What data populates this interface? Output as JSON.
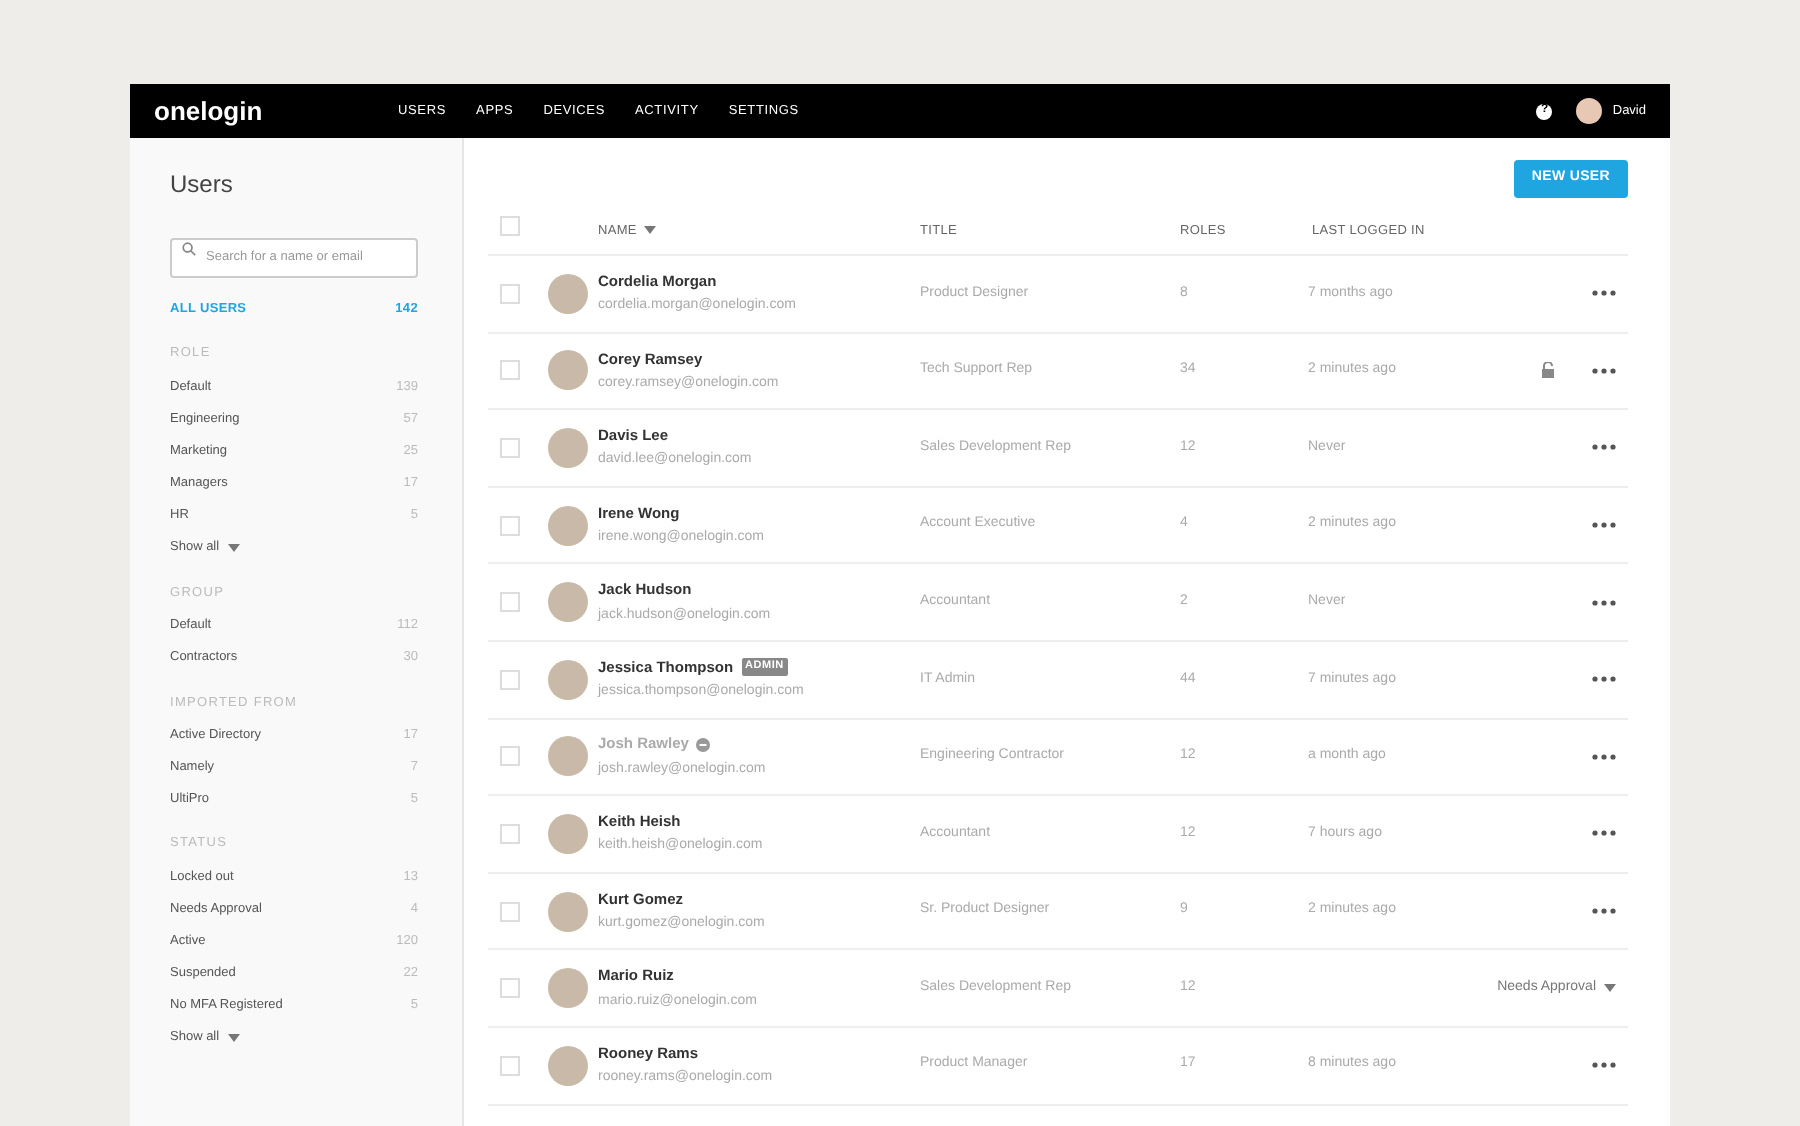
{
  "nav": {
    "logo": "onelogin",
    "links": [
      "USERS",
      "APPS",
      "DEVICES",
      "ACTIVITY",
      "SETTINGS"
    ],
    "help": "?",
    "user": "David"
  },
  "sidebar": {
    "title": "Users",
    "search": {
      "placeholder": "Search for a name or email"
    },
    "all": {
      "label": "ALL USERS",
      "count": "142",
      "selected": true
    },
    "sections": [
      {
        "heading": "ROLE",
        "items": [
          {
            "label": "Default",
            "count": "139",
            "selected": false
          },
          {
            "label": "Engineering",
            "count": "57",
            "selected": false
          },
          {
            "label": "Marketing",
            "count": "25",
            "selected": false
          },
          {
            "label": "Managers",
            "count": "17",
            "selected": false
          },
          {
            "label": "HR",
            "count": "5",
            "selected": false
          }
        ],
        "show_all": "Show all"
      },
      {
        "heading": "GROUP",
        "items": [
          {
            "label": "Default",
            "count": "112",
            "selected": false
          },
          {
            "label": "Contractors",
            "count": "30",
            "selected": false
          }
        ]
      },
      {
        "heading": "IMPORTED FROM",
        "items": [
          {
            "label": "Active Directory",
            "count": "17",
            "selected": false
          },
          {
            "label": "Namely",
            "count": "7",
            "selected": false
          },
          {
            "label": "UltiPro",
            "count": "5",
            "selected": false
          }
        ]
      },
      {
        "heading": "STATUS",
        "items": [
          {
            "label": "Locked out",
            "count": "13",
            "selected": false
          },
          {
            "label": "Needs Approval",
            "count": "4",
            "selected": false
          },
          {
            "label": "Active",
            "count": "120",
            "selected": false
          },
          {
            "label": "Suspended",
            "count": "22",
            "selected": false
          },
          {
            "label": "No MFA Registered",
            "count": "5",
            "selected": false
          }
        ],
        "show_all": "Show all"
      }
    ]
  },
  "new_user": "NEW USER",
  "table": {
    "select_all": {
      "checked": false
    },
    "columns": [
      "NAME",
      "TITLE",
      "ROLES",
      "LAST LOGGED IN"
    ],
    "rows": [
      {
        "name": "Cordelia Morgan",
        "email": "cordelia.morgan@onelogin.com",
        "title": "Product Designer",
        "roles": "8",
        "last": "7 months ago",
        "checked": false,
        "locked": false,
        "suspended": false
      },
      {
        "name": "Corey Ramsey",
        "email": "corey.ramsey@onelogin.com",
        "title": "Tech Support Rep",
        "roles": "34",
        "last": "2 minutes ago",
        "checked": false,
        "locked": true,
        "suspended": false
      },
      {
        "name": "Davis Lee",
        "email": "david.lee@onelogin.com",
        "title": "Sales Development Rep",
        "roles": "12",
        "last": "Never",
        "checked": false,
        "locked": false,
        "suspended": false
      },
      {
        "name": "Irene Wong",
        "email": "irene.wong@onelogin.com",
        "title": "Account Executive",
        "roles": "4",
        "last": "2 minutes ago",
        "checked": false,
        "locked": false,
        "suspended": false
      },
      {
        "name": "Jack Hudson",
        "email": "jack.hudson@onelogin.com",
        "title": "Accountant",
        "roles": "2",
        "last": "Never",
        "checked": false,
        "locked": false,
        "suspended": false
      },
      {
        "name": "Jessica Thompson",
        "badge": "ADMIN",
        "email": "jessica.thompson@onelogin.com",
        "title": "IT Admin",
        "roles": "44",
        "last": "7 minutes ago",
        "checked": false,
        "locked": false,
        "suspended": false
      },
      {
        "name": "Josh Rawley",
        "email": "josh.rawley@onelogin.com",
        "title": "Engineering Contractor",
        "roles": "12",
        "last": "a month ago",
        "checked": false,
        "locked": false,
        "suspended": true
      },
      {
        "name": "Keith Heish",
        "email": "keith.heish@onelogin.com",
        "title": "Accountant",
        "roles": "12",
        "last": "7 hours ago",
        "checked": false,
        "locked": false,
        "suspended": false
      },
      {
        "name": "Kurt Gomez",
        "email": "kurt.gomez@onelogin.com",
        "title": "Sr. Product Designer",
        "roles": "9",
        "last": "2 minutes ago",
        "checked": false,
        "locked": false,
        "suspended": false
      },
      {
        "name": "Mario Ruiz",
        "email": "mario.ruiz@onelogin.com",
        "title": "Sales Development Rep",
        "roles": "12",
        "action": "Needs Approval",
        "checked": false,
        "locked": false,
        "suspended": false
      },
      {
        "name": "Rooney Rams",
        "email": "rooney.rams@onelogin.com",
        "title": "Product Manager",
        "roles": "17",
        "last": "8 minutes ago",
        "checked": false,
        "locked": false,
        "suspended": false
      }
    ]
  }
}
